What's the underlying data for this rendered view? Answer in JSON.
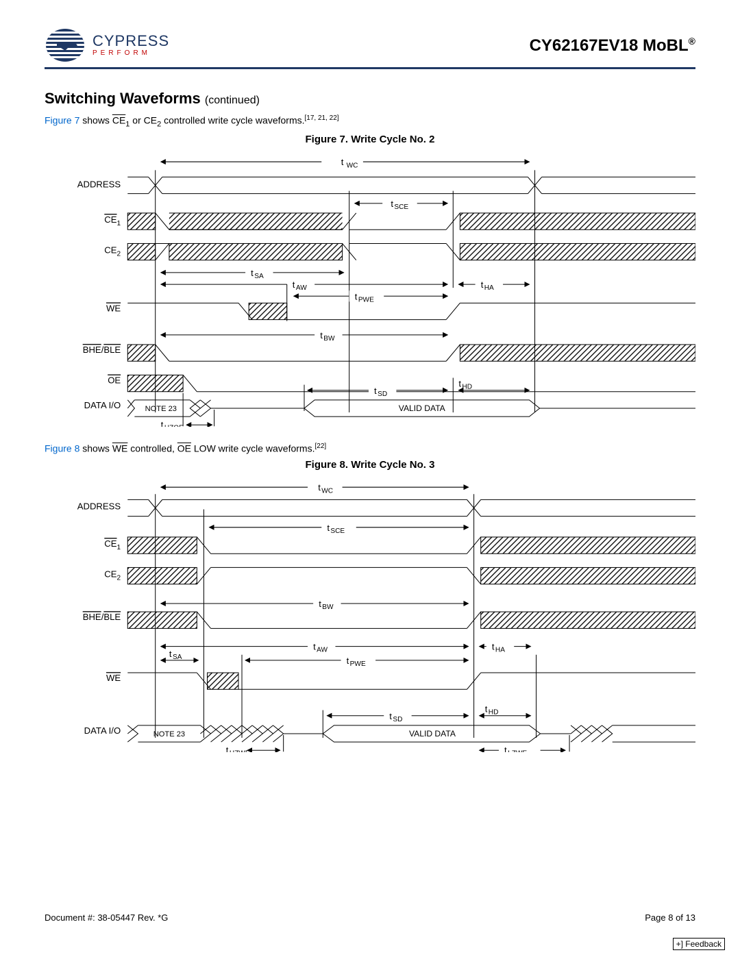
{
  "header": {
    "logo_main": "CYPRESS",
    "logo_sub": "PERFORM",
    "part_number": "CY62167EV18 MoBL",
    "registered": "®"
  },
  "section": {
    "title": "Switching Waveforms",
    "continued": "(continued)"
  },
  "intro7": {
    "link": "Figure 7",
    "text_before": " shows ",
    "sig1": "CE",
    "sub1": "1",
    "text_mid": " or CE",
    "sub2": "2",
    "text_after": " controlled write cycle waveforms.",
    "refs": "[17, 21, 22]"
  },
  "fig7": {
    "title": "Figure 7.  Write Cycle No. 2",
    "signals": {
      "address": "ADDRESS",
      "ce1": "CE",
      "ce1_sub": "1",
      "ce2": "CE",
      "ce2_sub": "2",
      "we": "WE",
      "bhe_ble": "BHE/BLE",
      "oe": "OE",
      "data_io": "DATA I/O"
    },
    "timing": {
      "twc": "tWC",
      "tsce": "tSCE",
      "tsa": "tSA",
      "taw": "tAW",
      "tha": "tHA",
      "tpwe": "tPWE",
      "tbw": "tBW",
      "tsd": "tSD",
      "thd": "tHD",
      "thzoe": "tHZOE"
    },
    "note23": "NOTE 23",
    "valid_data": "VALID DATA"
  },
  "intro8": {
    "link": "Figure 8",
    "text_before": " shows ",
    "sig1": "WE",
    "text_mid": " controlled, ",
    "sig2": "OE",
    "text_after": " LOW write cycle waveforms.",
    "refs": "[22]"
  },
  "fig8": {
    "title": "Figure 8.  Write Cycle No. 3",
    "signals": {
      "address": "ADDRESS",
      "ce1": "CE",
      "ce1_sub": "1",
      "ce2": "CE",
      "ce2_sub": "2",
      "bhe_ble": "BHE/BLE",
      "we": "WE",
      "data_io": "DATA I/O"
    },
    "timing": {
      "twc": "tWC",
      "tsce": "tSCE",
      "tbw": "tBW",
      "taw": "tAW",
      "tha": "tHA",
      "tsa": "tSA",
      "tpwe": "tPWE",
      "tsd": "tSD",
      "thd": "tHD",
      "thzwe": "tHZWE",
      "tlzwe": "tLZWE"
    },
    "note23": "NOTE 23",
    "valid_data": "VALID DATA"
  },
  "footer": {
    "doc": "Document #: 38-05447 Rev. *G",
    "page": "Page 8 of 13"
  },
  "feedback": "+] Feedback"
}
